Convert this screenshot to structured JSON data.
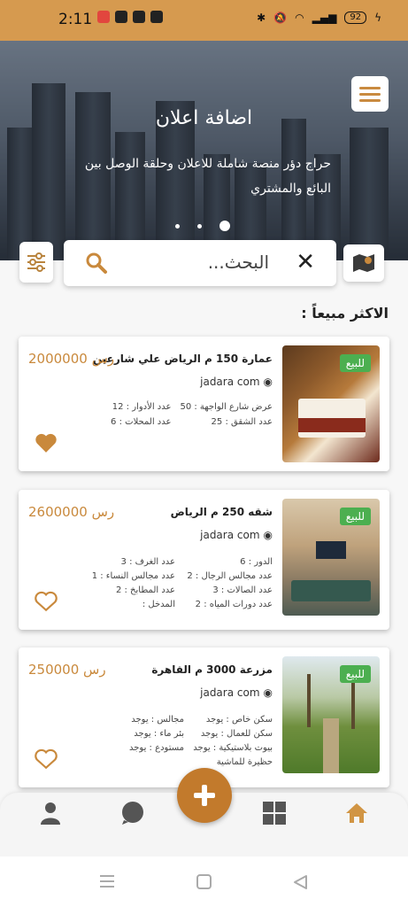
{
  "status_bar": {
    "time": "2:11",
    "battery": "92"
  },
  "hero": {
    "title": "اضافة اعلان",
    "description": "حراج دؤر منصة شاملة للاعلان وحلقة الوصل بين البائع والمشتري",
    "menu_icon": "menu-icon",
    "active_slide": 3,
    "slide_count": 3
  },
  "search": {
    "placeholder": "البحث..."
  },
  "section_title": "الاكثر مبيعاً :",
  "listings": [
    {
      "badge": "للبيع",
      "title": "عمارة 150 م الرياض علي شارعين",
      "price": "2000000 رس",
      "company": "jadara com",
      "favorite": true,
      "specs": [
        "عرض شارع الواجهة : 50",
        "عدد الأدوار : 12",
        "عدد الشقق : 25",
        "عدد المحلات : 6"
      ]
    },
    {
      "badge": "للبيع",
      "title": "شقه 250 م الرياض",
      "price": "2600000 رس",
      "company": "jadara com",
      "favorite": false,
      "specs": [
        "الدور : 6",
        "عدد الغرف : 3",
        "عدد مجالس الرجال : 2",
        "عدد مجالس النساء : 1",
        "عدد الصالات : 3",
        "عدد المطابخ : 2",
        "عدد دورات المياه : 2",
        "المدخل :"
      ]
    },
    {
      "badge": "للبيع",
      "title": "مزرعة 3000 م القاهرة",
      "price": "250000 رس",
      "company": "jadara com",
      "favorite": false,
      "specs": [
        "سكن خاص : يوجد",
        "مجالس : يوجد",
        "سكن للعمال : يوجد",
        "بئر ماء : يوجد",
        "بيوت بلاستيكية : يوجد",
        "مستودع : يوجد",
        "حظيرة للماشية"
      ]
    }
  ],
  "bottom_nav": {
    "items": [
      "home-icon",
      "grid-icon",
      "chat-icon",
      "profile-icon"
    ],
    "active": "home-icon",
    "fab_icon": "plus-icon"
  },
  "colors": {
    "accent": "#c9893c",
    "badge": "#4caf50",
    "status_bar": "#d69a4f"
  }
}
